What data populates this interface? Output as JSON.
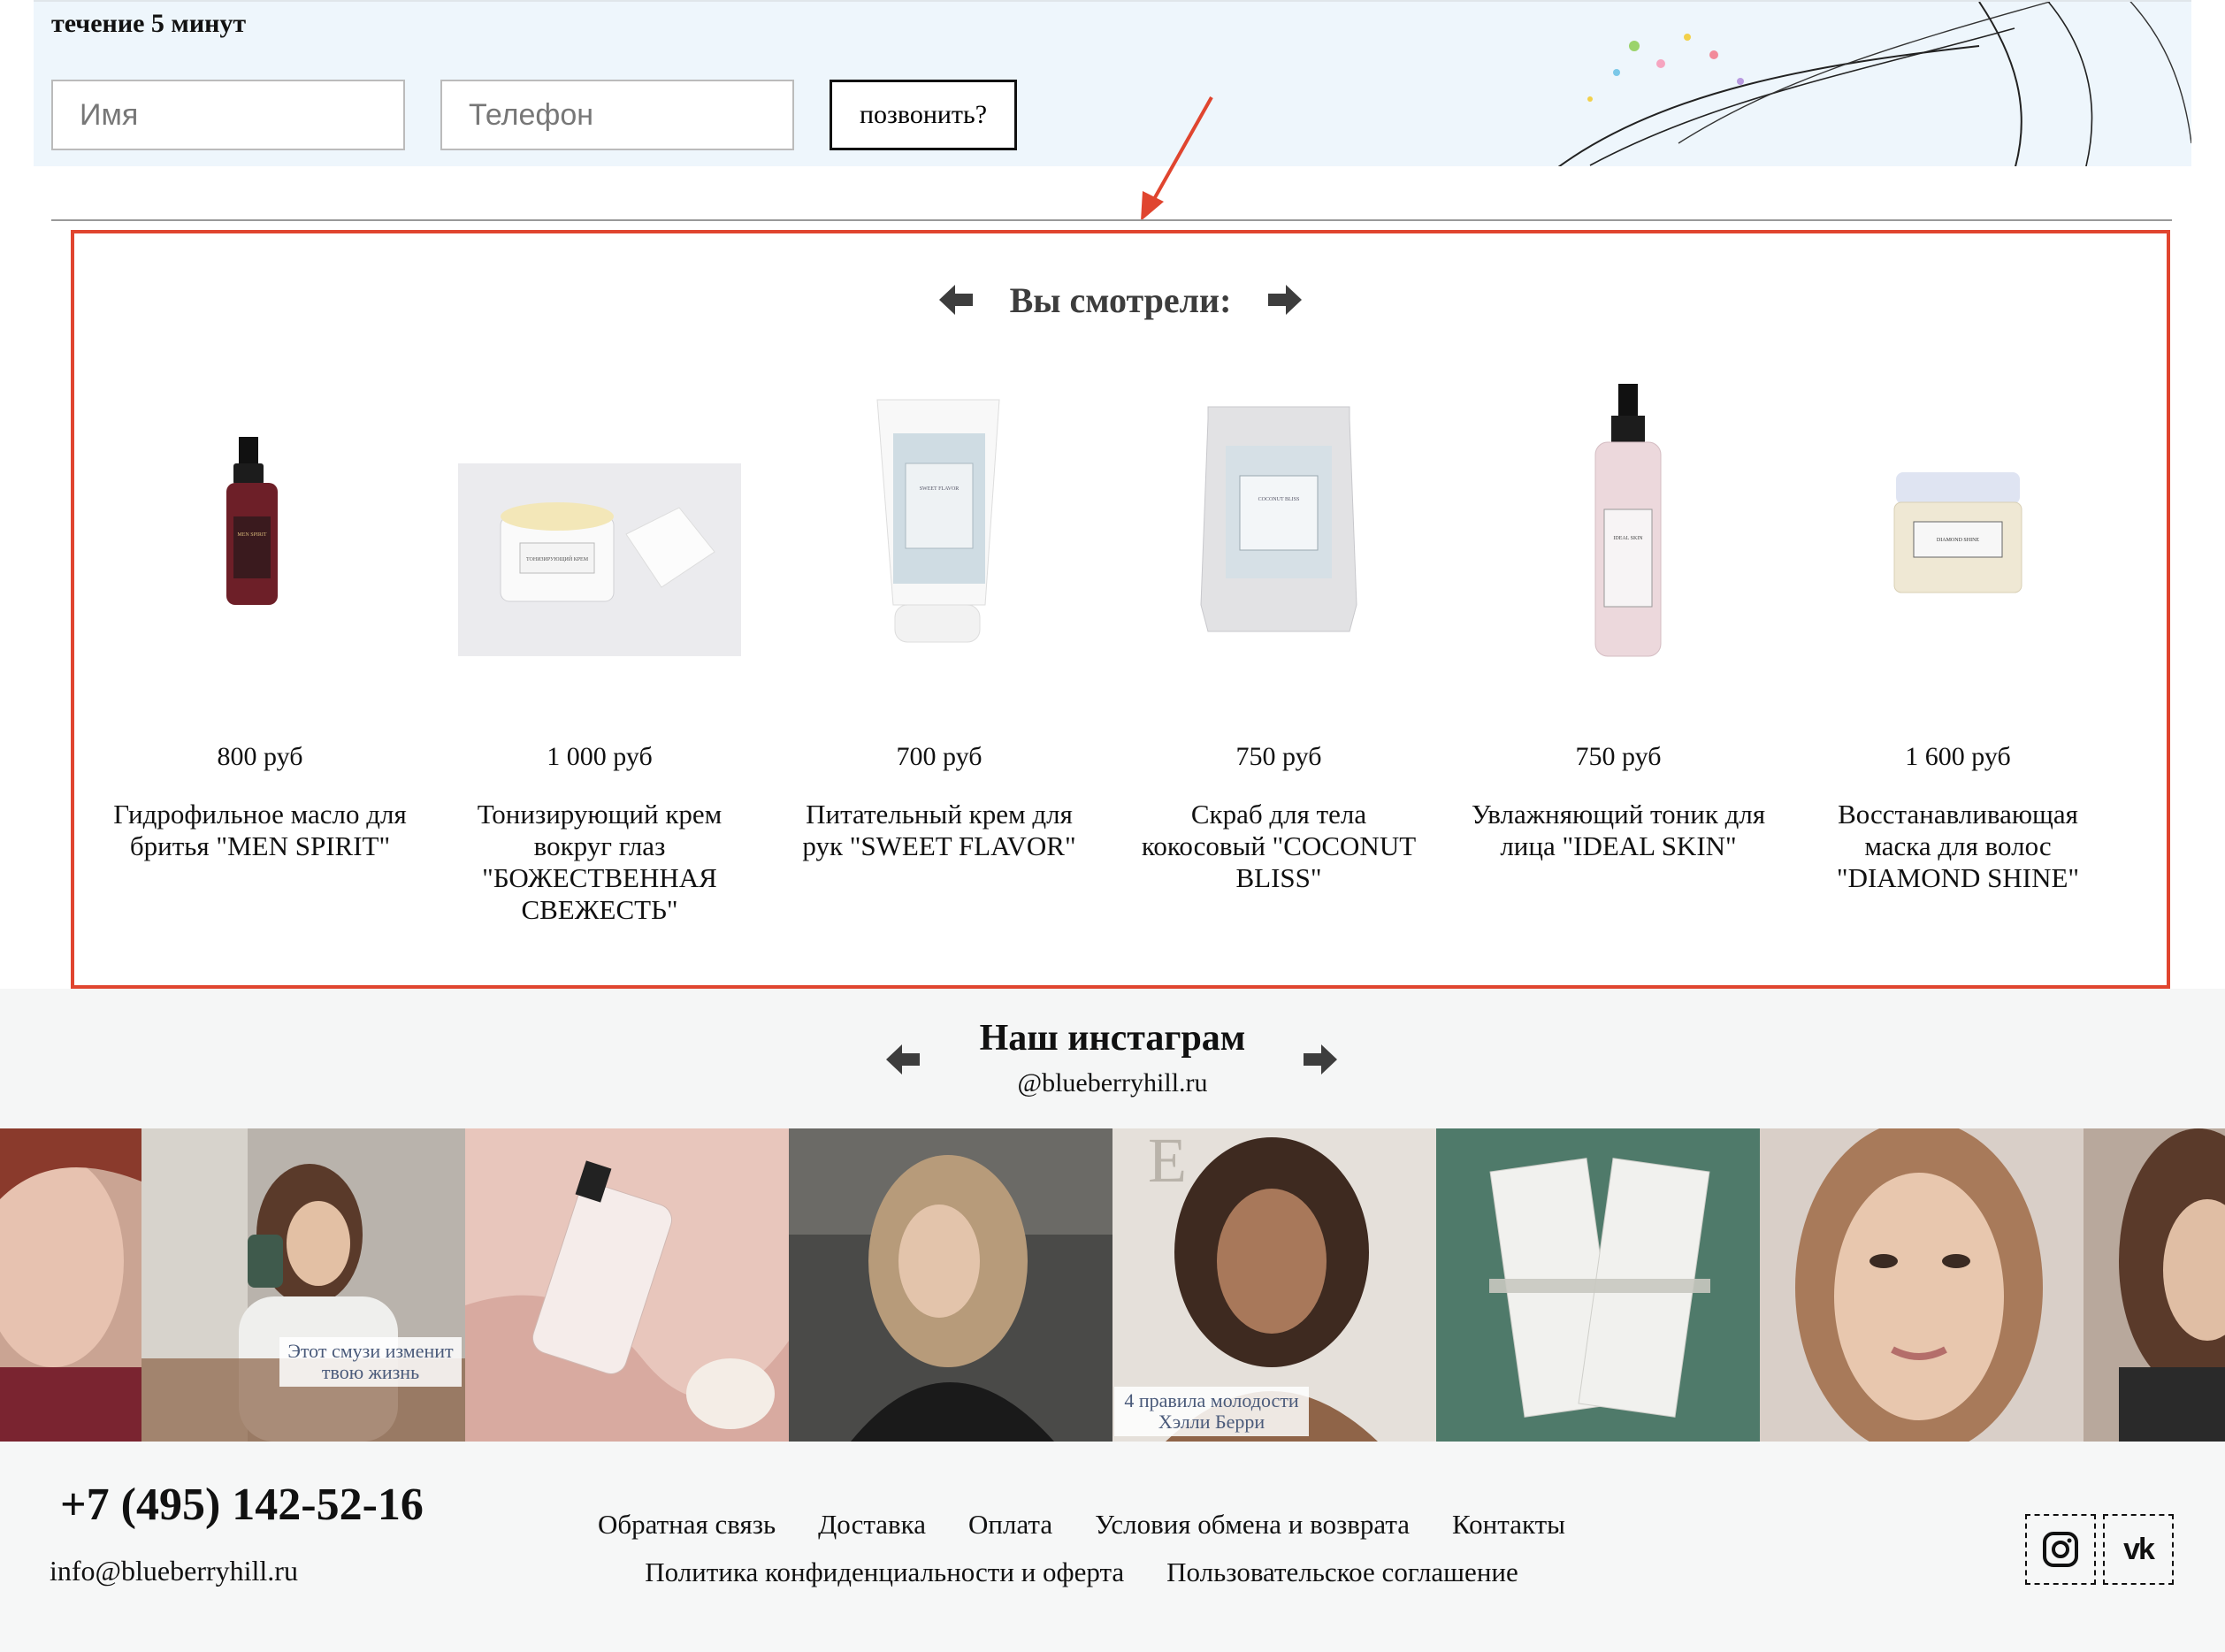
{
  "callback": {
    "text": "течение 5 минут",
    "name_placeholder": "Имя",
    "phone_placeholder": "Телефон",
    "button_label": "позвонить?"
  },
  "viewed": {
    "title": "Вы смотрели:",
    "products": [
      {
        "price": "800 руб",
        "name": "Гидрофильное масло для бритья \"MEN SPIRIT\"",
        "label": "MEN SPIRIT"
      },
      {
        "price": "1 000 руб",
        "name": "Тонизирующий крем вокруг глаз \"БОЖЕСТВЕННАЯ СВЕЖЕСТЬ\"",
        "label": "ТОНИЗИРУЮЩИЙ КРЕМ"
      },
      {
        "price": "700 руб",
        "name": "Питательный крем для рук \"SWEET FLAVOR\"",
        "label": "SWEET FLAVOR"
      },
      {
        "price": "750 руб",
        "name": "Скраб для тела кокосовый \"COCONUT BLISS\"",
        "label": "COCONUT BLISS"
      },
      {
        "price": "750 руб",
        "name": "Увлажняющий тоник для лица \"IDEAL SKIN\"",
        "label": "IDEAL SKIN"
      },
      {
        "price": "1 600 руб",
        "name": "Восстанавливающая маска для волос \"DIAMOND SHINE\"",
        "label": "DIAMOND SHINE"
      }
    ]
  },
  "instagram": {
    "title": "Наш инстаграм",
    "handle": "@blueberryhill.ru",
    "captions": {
      "smoothie": "Этот смузи изменит твою жизнь",
      "berry": "4 правила молодости Хэлли Берри",
      "magazine_letter": "E"
    }
  },
  "footer": {
    "phone": "+7 (495) 142-52-16",
    "email": "info@blueberryhill.ru",
    "links_row1": [
      "Обратная связь",
      "Доставка",
      "Оплата",
      "Условия обмена и возврата",
      "Контакты"
    ],
    "links_row2": [
      "Политика конфиденциальности и оферта",
      "Пользовательское соглашение"
    ],
    "social": {
      "instagram_icon": "instagram-icon",
      "vk_label": "vk"
    }
  },
  "colors": {
    "callback_bg": "#eef6fc",
    "highlight_border": "#e0452f",
    "footer_bg": "#f6f7f7",
    "title_gray": "#3d3d3d"
  }
}
